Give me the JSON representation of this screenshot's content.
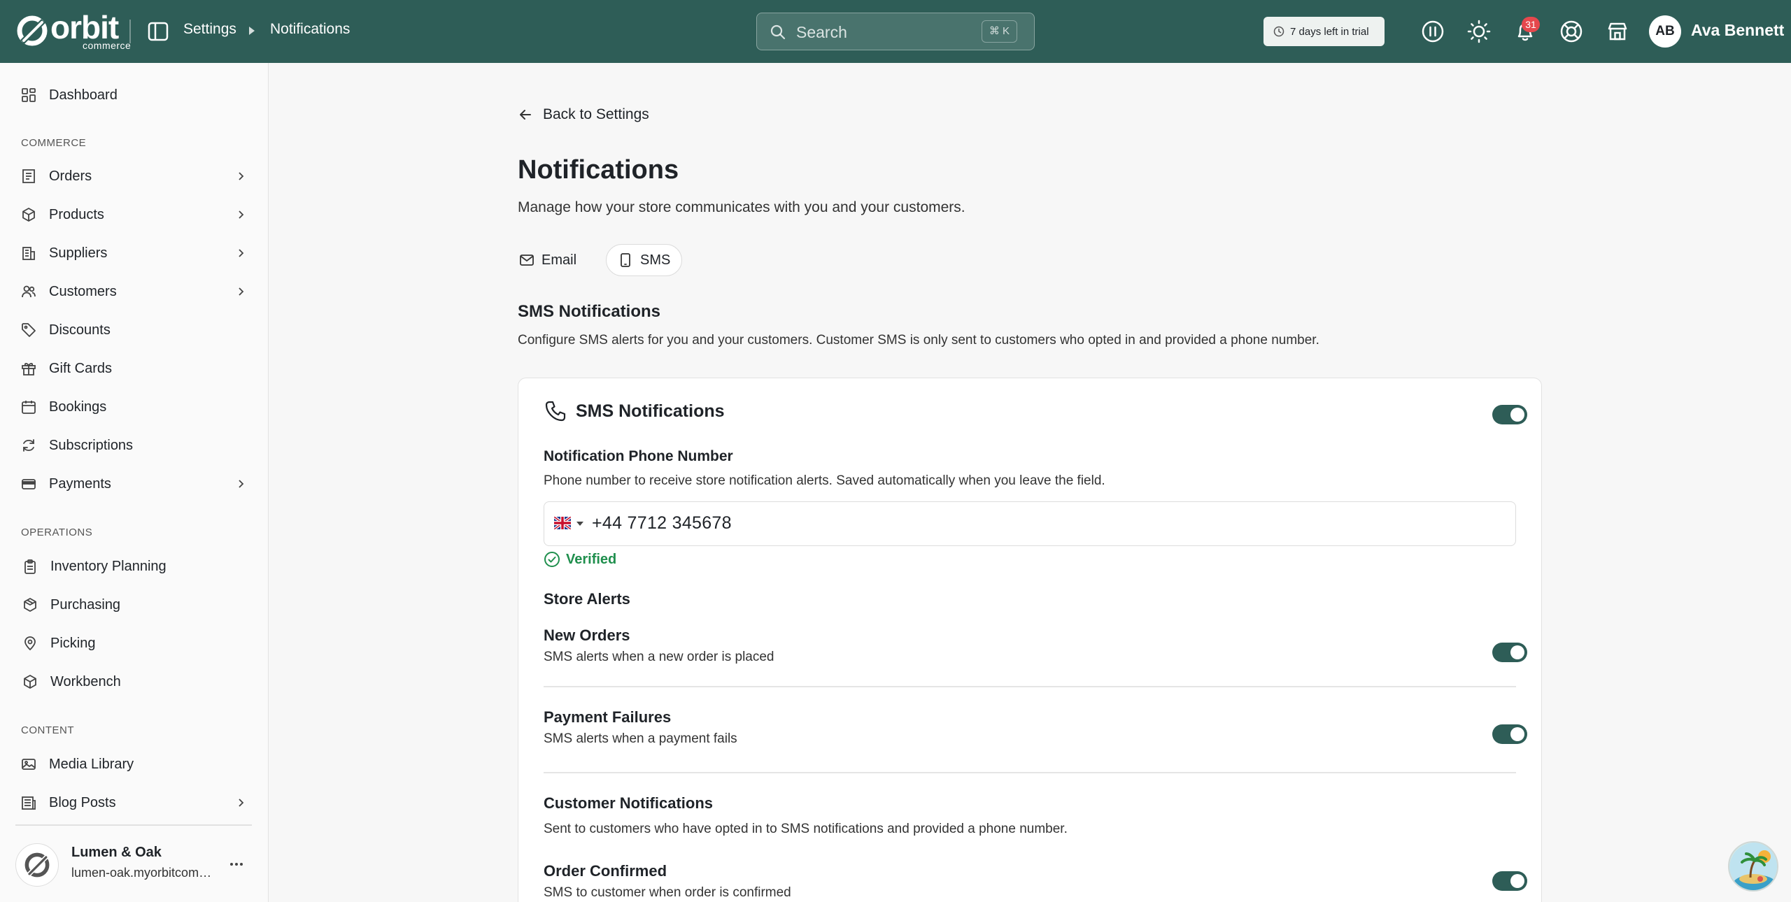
{
  "brand": {
    "name": "orbit",
    "sub": "commerce"
  },
  "breadcrumb": {
    "parent": "Settings",
    "current": "Notifications"
  },
  "search": {
    "placeholder": "Search",
    "shortcut": "⌘ K"
  },
  "trial": {
    "label": "7 days left in trial"
  },
  "topbar_icons": [
    "pause-icon",
    "sun-icon",
    "bell-icon",
    "help-icon",
    "store-icon"
  ],
  "notifications": {
    "count": "31"
  },
  "user": {
    "initials": "AB",
    "name": "Ava Bennett"
  },
  "sidebar": {
    "dashboard": "Dashboard",
    "sections": {
      "commerce": "COMMERCE",
      "operations": "OPERATIONS",
      "content": "CONTENT"
    },
    "items": {
      "orders": "Orders",
      "products": "Products",
      "suppliers": "Suppliers",
      "customers": "Customers",
      "discounts": "Discounts",
      "gift_cards": "Gift Cards",
      "bookings": "Bookings",
      "subscriptions": "Subscriptions",
      "payments": "Payments",
      "inventory_planning": "Inventory Planning",
      "purchasing": "Purchasing",
      "picking": "Picking",
      "workbench": "Workbench",
      "media_library": "Media Library",
      "blog_posts": "Blog Posts"
    },
    "store": {
      "name": "Lumen & Oak",
      "url": "lumen-oak.myorbitcommerce.com"
    }
  },
  "page": {
    "back": "Back to Settings",
    "title": "Notifications",
    "subtitle": "Manage how your store communicates with you and your customers.",
    "tabs": {
      "email": "Email",
      "sms": "SMS"
    },
    "section_title": "SMS Notifications",
    "section_subtitle": "Configure SMS alerts for you and your customers. Customer SMS is only sent to customers who opted in and provided a phone number."
  },
  "card": {
    "title": "SMS Notifications",
    "enabled": true,
    "phone_label": "Notification Phone Number",
    "phone_help": "Phone number to receive store notification alerts. Saved automatically when you leave the field.",
    "phone_value": "+44  7712 345678",
    "verified": "Verified",
    "store_alerts": {
      "title": "Store Alerts",
      "rows": [
        {
          "title": "New Orders",
          "desc": "SMS alerts when a new order is placed",
          "enabled": true
        },
        {
          "title": "Payment Failures",
          "desc": "SMS alerts when a payment fails",
          "enabled": true
        }
      ]
    },
    "customer_notifications": {
      "title": "Customer Notifications",
      "subtitle": "Sent to customers who have opted in to SMS notifications and provided a phone number.",
      "rows": [
        {
          "title": "Order Confirmed",
          "desc": "SMS to customer when order is confirmed",
          "enabled": true
        }
      ]
    }
  },
  "colors": {
    "primary": "#2e5d57",
    "success": "#1f8f4d",
    "badge": "#e5484d"
  }
}
